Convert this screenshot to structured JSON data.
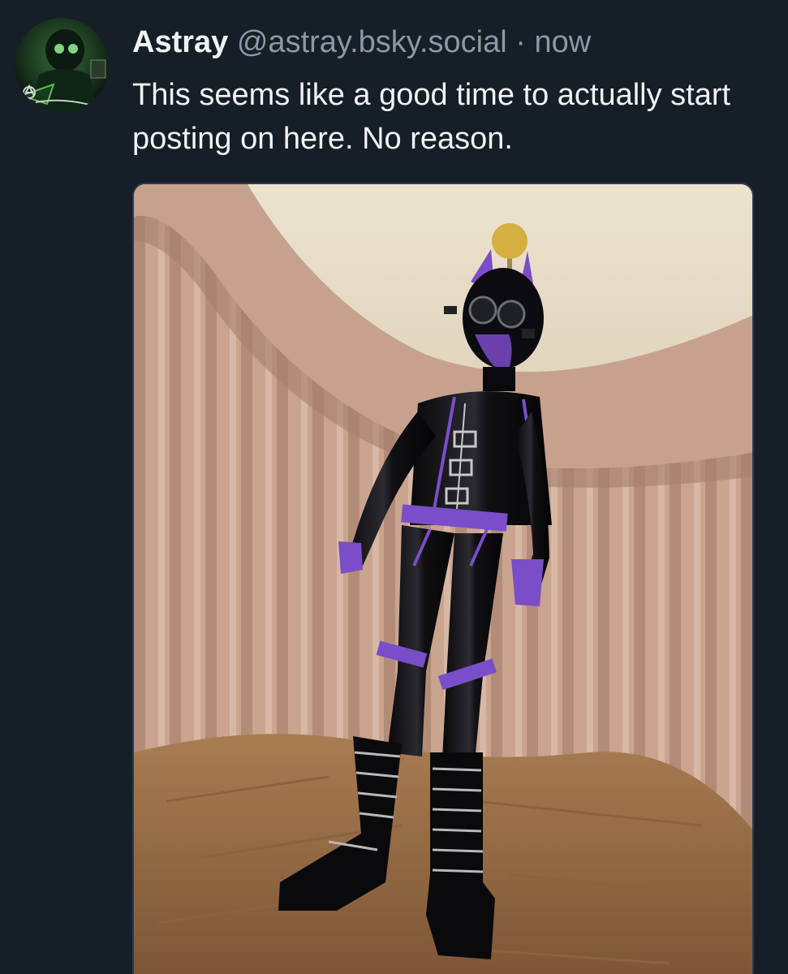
{
  "post": {
    "author": {
      "display_name": "Astray",
      "handle": "@astray.bsky.social",
      "avatar_icon": "user-avatar-icon"
    },
    "separator": "·",
    "timestamp": "now",
    "text": "This seems like a good time to actually start posting on here. No reason.",
    "media": {
      "type": "photo",
      "alt_icon": "photo-icon"
    }
  },
  "colors": {
    "background": "#161e27",
    "primary_text": "#f1f3f5",
    "secondary_text": "#8b98a5",
    "media_border": "#2e3a48"
  }
}
